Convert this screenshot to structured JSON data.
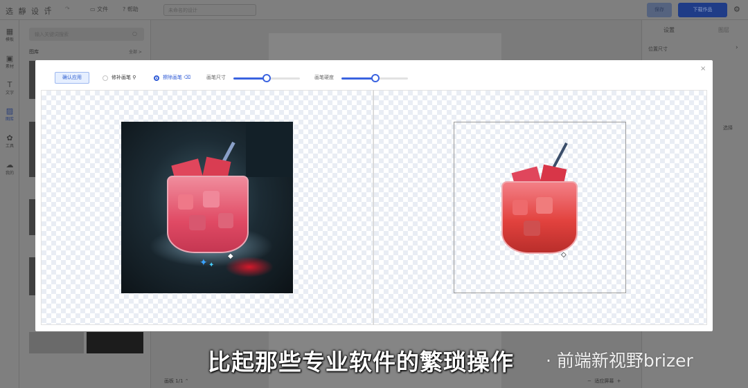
{
  "app": {
    "logo": "选 靜 设 计",
    "menu": {
      "file": "文件",
      "help": "帮助"
    },
    "doc_name_placeholder": "未命名的设计",
    "save_label": "保存",
    "download_label": "下载作品"
  },
  "left_rail": {
    "items": [
      {
        "label": "模板",
        "icon": "template-icon"
      },
      {
        "label": "素材",
        "icon": "material-icon"
      },
      {
        "label": "文字",
        "icon": "text-icon"
      },
      {
        "label": "图库",
        "icon": "gallery-icon"
      },
      {
        "label": "工具",
        "icon": "tools-icon"
      },
      {
        "label": "我的",
        "icon": "cloud-icon"
      }
    ]
  },
  "asset_panel": {
    "search_placeholder": "输入关键词搜索",
    "section_title": "图库",
    "more_label": "全部 >"
  },
  "right_panel": {
    "tabs": [
      "设置",
      "图层"
    ],
    "position_size": "位置尺寸",
    "select_label": "选择"
  },
  "canvas_footer": {
    "board_label": "画板 1/1",
    "fit_label": "适应屏幕"
  },
  "brush_modal": {
    "confirm_label": "确认应用",
    "repair_brush_label": "修补画笔",
    "erase_brush_label": "擦除画笔",
    "selected_mode": "erase",
    "size_label": "画笔尺寸",
    "size_value": 0.5,
    "hardness_label": "画笔硬度",
    "hardness_value": 0.5,
    "close_label": "×"
  },
  "subtitle": "比起那些专业软件的繁琐操作",
  "watermark": "· 前端新视野brizer",
  "colors": {
    "accent": "#3a63e0",
    "download": "#1f3c87"
  }
}
